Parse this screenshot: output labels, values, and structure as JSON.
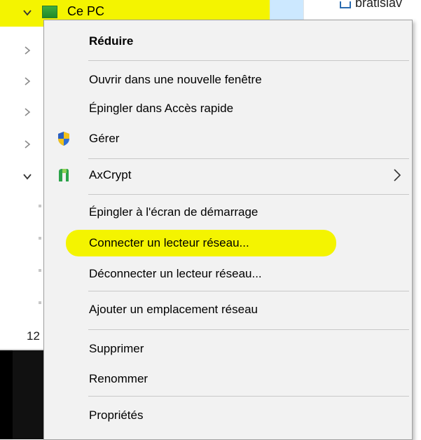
{
  "nav": {
    "this_pc_label": "Ce PC",
    "item_count": "12"
  },
  "right_pane": {
    "file_label": "bratislav"
  },
  "menu": {
    "items": [
      {
        "id": "collapse",
        "label": "Réduire",
        "bold": true
      },
      {
        "id": "open-new-window",
        "label": "Ouvrir dans une nouvelle fenêtre"
      },
      {
        "id": "pin-quick-access",
        "label": "Épingler dans Accès rapide"
      },
      {
        "id": "manage",
        "label": "Gérer",
        "icon": "shield-icon"
      },
      {
        "id": "axcrypt",
        "label": "AxCrypt",
        "icon": "axcrypt-icon",
        "submenu": true
      },
      {
        "id": "pin-start",
        "label": "Épingler à l'écran de démarrage"
      },
      {
        "id": "map-network-drive",
        "label": "Connecter un lecteur réseau...",
        "highlighted": true
      },
      {
        "id": "disconnect-network-drive",
        "label": "Déconnecter un lecteur réseau..."
      },
      {
        "id": "add-network-location",
        "label": "Ajouter un emplacement réseau"
      },
      {
        "id": "delete",
        "label": "Supprimer"
      },
      {
        "id": "rename",
        "label": "Renommer"
      },
      {
        "id": "properties",
        "label": "Propriétés"
      }
    ]
  },
  "colors": {
    "highlight": "#f4f400",
    "selection": "#cce8ff",
    "menu_background": "#f2f2f2",
    "separator": "#c8c8c8"
  }
}
